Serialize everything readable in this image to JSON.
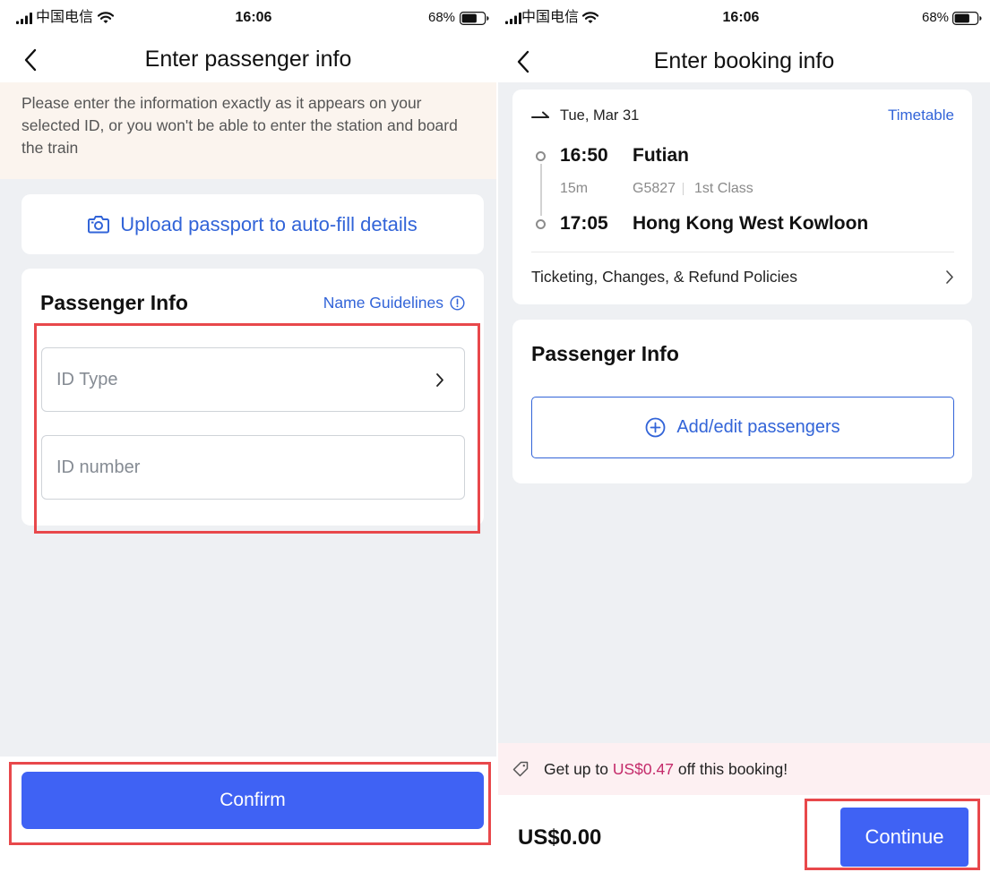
{
  "colors": {
    "accent": "#3f62f4",
    "link": "#3264d8",
    "highlight": "#e8484b",
    "promo_amount": "#c42a6a",
    "page_bg": "#eef0f3",
    "notice_bg": "#fbf4ee",
    "promo_bg": "#fdf0f2"
  },
  "passenger_screen": {
    "status": {
      "carrier": "中国电信",
      "time": "16:06",
      "battery": "68%"
    },
    "header": {
      "title": "Enter passenger info",
      "back_icon": "chevron-left-icon"
    },
    "notice": "Please enter the information exactly as it appears on your selected ID, or you won't be able to enter the station and board the train",
    "upload": {
      "icon": "camera-icon",
      "label": "Upload passport to auto-fill details"
    },
    "passenger_card": {
      "title": "Passenger Info",
      "guidelines_label": "Name Guidelines",
      "guidelines_icon": "info-icon",
      "fields": [
        {
          "placeholder": "ID Type",
          "icon": "chevron-right-icon"
        },
        {
          "placeholder": "ID number"
        }
      ]
    },
    "confirm_label": "Confirm"
  },
  "booking_screen": {
    "status": {
      "carrier": "中国电信",
      "time": "16:06",
      "battery": "68%"
    },
    "header": {
      "title": "Enter booking info",
      "back_icon": "chevron-left-icon"
    },
    "trip": {
      "direction_icon": "arrow-right-icon",
      "date": "Tue, Mar 31",
      "timetable_label": "Timetable",
      "depart_time": "16:50",
      "depart_station": "Futian",
      "duration": "15m",
      "train_no": "G5827",
      "seat_class": "1st Class",
      "arrive_time": "17:05",
      "arrive_station": "Hong Kong West Kowloon",
      "policies_label": "Ticketing, Changes, & Refund Policies"
    },
    "passenger_card": {
      "title": "Passenger Info",
      "add_label": "Add/edit passengers",
      "add_icon": "plus-circle-icon"
    },
    "promo": {
      "icon": "tag-icon",
      "prefix": "Get up to",
      "amount": "US$0.47",
      "suffix": "off this booking!"
    },
    "total": "US$0.00",
    "continue_label": "Continue"
  }
}
